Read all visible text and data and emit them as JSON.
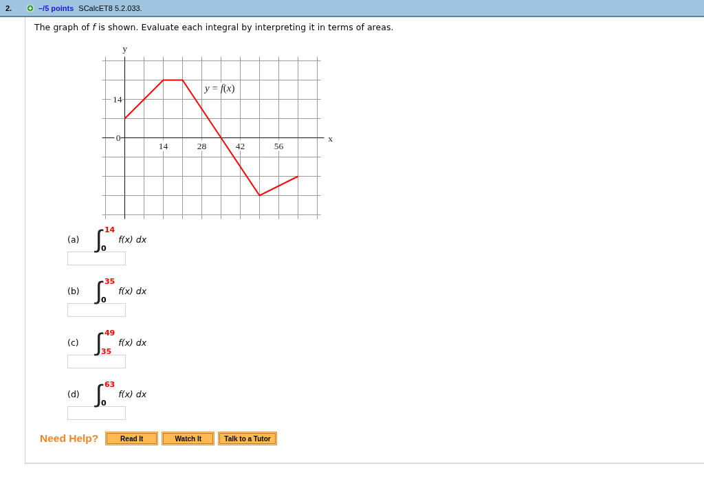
{
  "question": {
    "number": "2.",
    "points": "–/5 points",
    "source": "SCalcET8 5.2.033."
  },
  "prompt": "The graph of *f* is shown. Evaluate each integral by interpreting it in terms of areas.",
  "graph": {
    "chart_data": {
      "type": "line",
      "xlabel": "x",
      "ylabel": "y",
      "x": [
        0,
        14,
        21,
        35,
        49,
        63
      ],
      "values": [
        7,
        21,
        21,
        0,
        -21,
        -14
      ],
      "color": "#ff0000",
      "xticks": [
        14,
        28,
        42,
        56
      ],
      "yticks": [
        0,
        14
      ],
      "xlim": [
        -7,
        70
      ],
      "ylim": [
        -28,
        28
      ],
      "grid": true,
      "annotations": [
        "*y* = *f*(*x*)"
      ]
    }
  },
  "parts": [
    {
      "label": "(a)",
      "integral": "∫",
      "upper": {
        "text": "14",
        "color": "#ff0000"
      },
      "lower": {
        "text": "0",
        "color": "#000000"
      },
      "integrand": "f(x) dx"
    },
    {
      "label": "(b)",
      "integral": "∫",
      "upper": {
        "text": "35",
        "color": "#ff0000"
      },
      "lower": {
        "text": "0",
        "color": "#000000"
      },
      "integrand": "f(x) dx"
    },
    {
      "label": "(c)",
      "integral": "∫",
      "upper": {
        "text": "49",
        "color": "#ff0000"
      },
      "lower": {
        "text": "35",
        "color": "#ff0000"
      },
      "integrand": "f(x) dx"
    },
    {
      "label": "(d)",
      "integral": "∫",
      "upper": {
        "text": "63",
        "color": "#ff0000"
      },
      "lower": {
        "text": "0",
        "color": "#000000"
      },
      "integrand": "f(x) dx"
    }
  ],
  "help": {
    "label": "Need Help?",
    "buttons": [
      "Read It",
      "Watch It",
      "Talk to a Tutor"
    ]
  }
}
